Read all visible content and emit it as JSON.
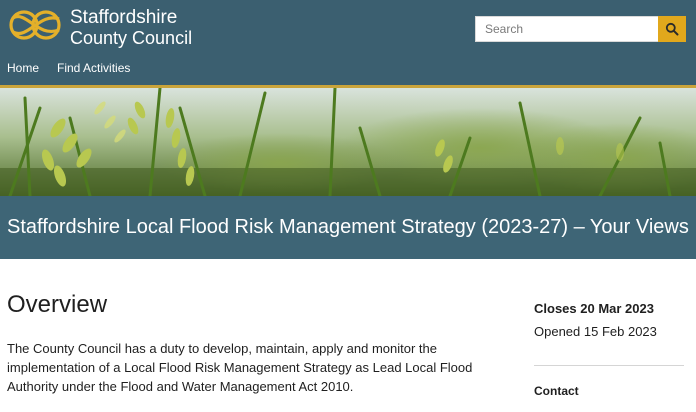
{
  "header": {
    "logo_line1": "Staffordshire",
    "logo_line2": "County Council",
    "logo_icon": "staffordshire-knot-icon",
    "search": {
      "placeholder": "Search",
      "button_icon": "search-icon"
    }
  },
  "nav": {
    "items": [
      {
        "label": "Home"
      },
      {
        "label": "Find Activities"
      }
    ]
  },
  "banner": {
    "image": "green-wheat-field-photo"
  },
  "page": {
    "title": "Staffordshire Local Flood Risk Management Strategy (2023-27) – Your Views"
  },
  "overview": {
    "heading": "Overview",
    "text": "The County Council has a duty to develop, maintain, apply and monitor the implementation of a Local Flood Risk Management Strategy as Lead Local Flood Authority under the Flood and Water Management Act 2010."
  },
  "sidebar": {
    "closes": "Closes 20 Mar 2023",
    "opened": "Opened 15 Feb 2023",
    "contact_heading": "Contact"
  },
  "colors": {
    "header_bg": "#3b5f70",
    "title_band_bg": "#3e6576",
    "accent_gold": "#caa43a",
    "search_button": "#e1a81c"
  }
}
